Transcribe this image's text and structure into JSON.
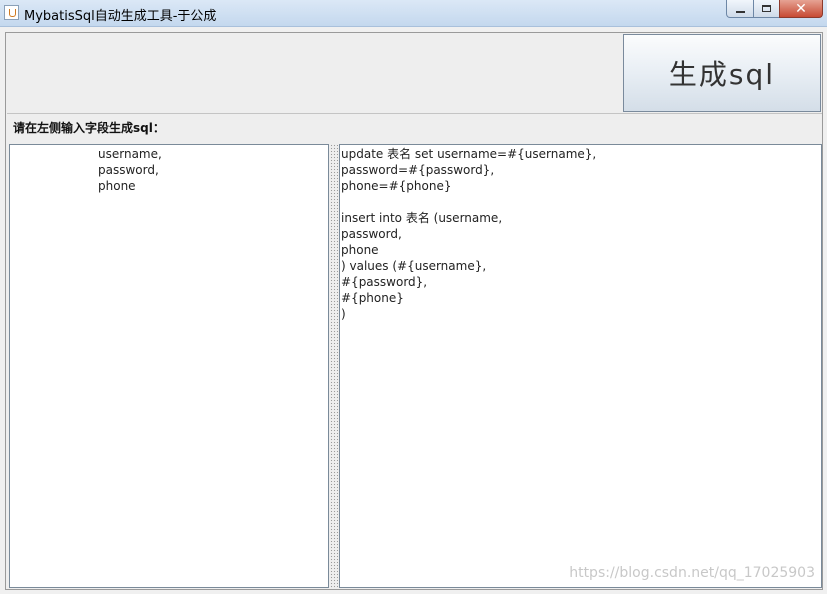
{
  "window": {
    "title": "MybatisSql自动生成工具-于公成",
    "close_label": "✕"
  },
  "toolbar": {
    "generate_label": "生成sql"
  },
  "hint_text": "请在左侧输入字段生成sql：",
  "input_text": "username,\npassword,\nphone",
  "output_text": "update 表名 set username=#{username},\npassword=#{password},\nphone=#{phone}\n\ninsert into 表名 (username,\npassword,\nphone\n) values (#{username},\n#{password},\n#{phone}\n)",
  "watermark": "https://blog.csdn.net/qq_17025903",
  "icons": {
    "app": "java-app-icon",
    "minimize": "minimize-icon",
    "maximize": "maximize-icon",
    "close": "close-icon"
  },
  "colors": {
    "titlebar": "#c4d8ee",
    "close_button": "#c74a33",
    "background": "#eeeeee"
  }
}
